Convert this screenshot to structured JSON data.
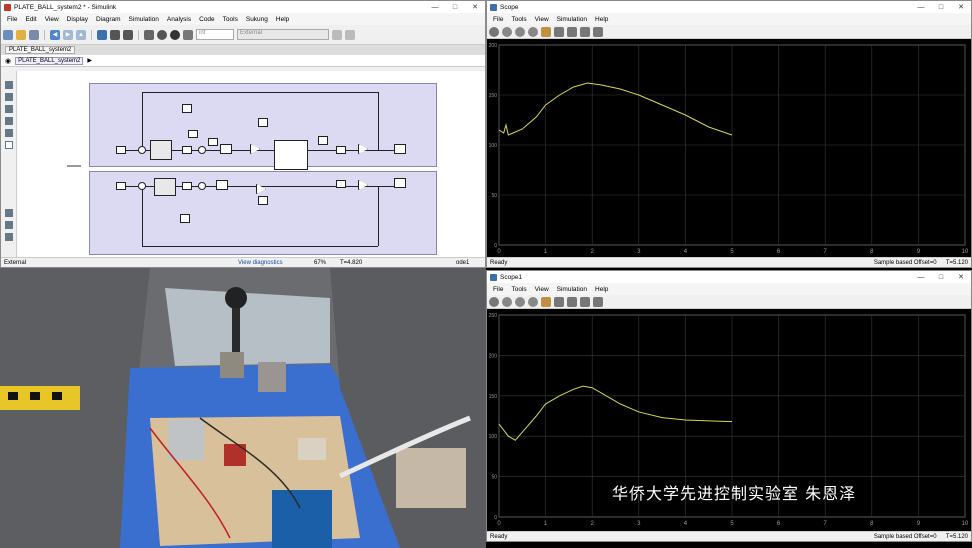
{
  "simulink": {
    "title": "PLATE_BALL_system2 * - Simulink",
    "menus": [
      "File",
      "Edit",
      "View",
      "Display",
      "Diagram",
      "Simulation",
      "Analysis",
      "Code",
      "Tools",
      "Sukung",
      "Help"
    ],
    "stop_time": "inf",
    "mode": "External",
    "model_tab": "PLATE_BALL_system2",
    "breadcrumb": "PLATE_BALL_system2",
    "status": {
      "left": "External",
      "diag": "View diagnostics",
      "zoom": "67%",
      "time": "T=4.820",
      "solver": "ode1"
    }
  },
  "scope1": {
    "title": "Scope",
    "menus": [
      "File",
      "Tools",
      "View",
      "Simulation",
      "Help"
    ],
    "status": {
      "left": "Ready",
      "mode": "Sample based",
      "offset": "Offset=0",
      "time": "T=5.120"
    }
  },
  "scope2": {
    "title": "Scope1",
    "menus": [
      "File",
      "Tools",
      "View",
      "Simulation",
      "Help"
    ],
    "status": {
      "left": "Ready",
      "mode": "Sample based",
      "offset": "Offset=0",
      "time": "T=5.120"
    }
  },
  "chart_data": [
    {
      "type": "line",
      "xlim": [
        0,
        10
      ],
      "ylim": [
        0,
        200
      ],
      "x_ticks": [
        "0",
        "1",
        "2",
        "3",
        "4",
        "5",
        "6",
        "7",
        "8",
        "9",
        "10"
      ],
      "y_ticks": [
        "0",
        "50",
        "100",
        "150",
        "200"
      ],
      "grid": true,
      "series": [
        {
          "color": "#d8d848",
          "x": [
            0,
            0.1,
            0.15,
            0.2,
            0.3,
            0.5,
            0.8,
            1.0,
            1.3,
            1.6,
            1.9,
            2.2,
            2.6,
            3.0,
            3.5,
            4.0,
            4.5,
            5.0
          ],
          "y": [
            115,
            112,
            120,
            110,
            112,
            116,
            128,
            140,
            150,
            158,
            162,
            160,
            156,
            150,
            140,
            130,
            118,
            110
          ]
        }
      ]
    },
    {
      "type": "line",
      "xlim": [
        0,
        10
      ],
      "ylim": [
        0,
        250
      ],
      "x_ticks": [
        "0",
        "1",
        "2",
        "3",
        "4",
        "5",
        "6",
        "7",
        "8",
        "9",
        "10"
      ],
      "y_ticks": [
        "0",
        "50",
        "100",
        "150",
        "200",
        "250"
      ],
      "grid": true,
      "series": [
        {
          "color": "#d8d848",
          "x": [
            0,
            0.2,
            0.35,
            0.5,
            0.8,
            1.0,
            1.3,
            1.6,
            1.8,
            2.0,
            2.3,
            2.6,
            3.0,
            3.5,
            4.0,
            4.5,
            5.0
          ],
          "y": [
            115,
            100,
            95,
            105,
            125,
            140,
            150,
            158,
            162,
            160,
            150,
            140,
            130,
            123,
            120,
            119,
            118
          ]
        }
      ]
    }
  ],
  "subtitle": "华侨大学先进控制实验室 朱恩泽"
}
